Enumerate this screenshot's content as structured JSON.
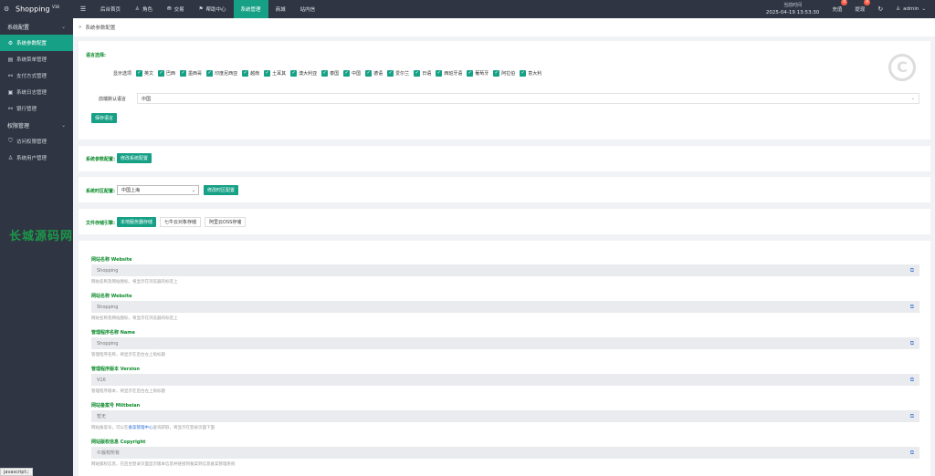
{
  "brand": {
    "name": "Shopping",
    "version": "V16"
  },
  "sidebar": {
    "groups": [
      {
        "label": "系统配置",
        "items": [
          {
            "label": "系统参数配置",
            "icon": "gear-icon",
            "active": true
          },
          {
            "label": "系统菜单管理",
            "icon": "menu-icon"
          },
          {
            "label": "支付方式管理",
            "icon": "link-icon"
          },
          {
            "label": "系统日志管理",
            "icon": "log-icon"
          },
          {
            "label": "银行管理",
            "icon": "link-icon"
          }
        ]
      },
      {
        "label": "权限管理",
        "items": [
          {
            "label": "访问权限管理",
            "icon": "shield-icon"
          },
          {
            "label": "系统用户管理",
            "icon": "user-icon"
          }
        ]
      }
    ]
  },
  "topnav": {
    "items": [
      "后台首页",
      "角色",
      "交易",
      "帮助中心",
      "系统管理",
      "商城",
      "站内信"
    ],
    "active_index": 4,
    "time_label": "当前时间",
    "time_value": "2025-04-19 13:53:30",
    "recharge": {
      "label": "充值",
      "count": "0"
    },
    "withdraw": {
      "label": "提现",
      "count": "0"
    },
    "user": "admin"
  },
  "breadcrumb": "系统参数配置",
  "lang_section": {
    "title": "语言选择:",
    "display_label": "显示选项",
    "languages": [
      "英文",
      "巴西",
      "墨西哥",
      "印度尼西亚",
      "越南",
      "土耳其",
      "澳大利亚",
      "泰国",
      "中国",
      "德语",
      "爱尔兰",
      "日语",
      "西班牙语",
      "葡萄牙",
      "阿拉伯",
      "意大利"
    ],
    "default_label": "前端默认语言",
    "default_value": "中国",
    "save_label": "保存语言"
  },
  "sys_param": {
    "label": "系统参数配置:",
    "button": "修改系统配置"
  },
  "timezone": {
    "label": "系统时区配置:",
    "value": "中国上海",
    "button": "修改时区配置"
  },
  "storage": {
    "label": "文件存储引擎:",
    "options": [
      "本地服务器存储",
      "七牛云对象存储",
      "阿里云OSS存储"
    ],
    "active_index": 0
  },
  "fields": [
    {
      "label": "网站名称 Website",
      "value": "Shopping",
      "hint": "网站名称及网站图标，将显示在浏览器的标签上"
    },
    {
      "label": "网站名称 Website",
      "value": "Shopping",
      "hint": "网站名称及网站图标，将显示在浏览器的标签上"
    },
    {
      "label": "管理程序名称 Name",
      "value": "Shopping",
      "hint": "管理程序名称，将显示在后台左上角标题"
    },
    {
      "label": "管理程序版本 Version",
      "value": "V16",
      "hint": "管理程序版本，将显示在后台左上角标题"
    },
    {
      "label": "网站备案号 Miitbeian",
      "value": "暂无",
      "hint_pre": "网站备案号，可以在",
      "hint_link": "备案管理中心",
      "hint_post": "查询获取，将显示在登录页面下面"
    },
    {
      "label": "网站版权信息 Copyright",
      "value": "©版权所有",
      "hint": "网站版权信息，在后台登录页面显示版本信息并链接到备案到信息备案管理系统"
    }
  ],
  "watermark": "长城源码网",
  "status_bar": "javascript:;",
  "colors": {
    "accent": "#16a085",
    "sidebar_bg": "#2f3542",
    "label_green": "#0b8a2a"
  }
}
